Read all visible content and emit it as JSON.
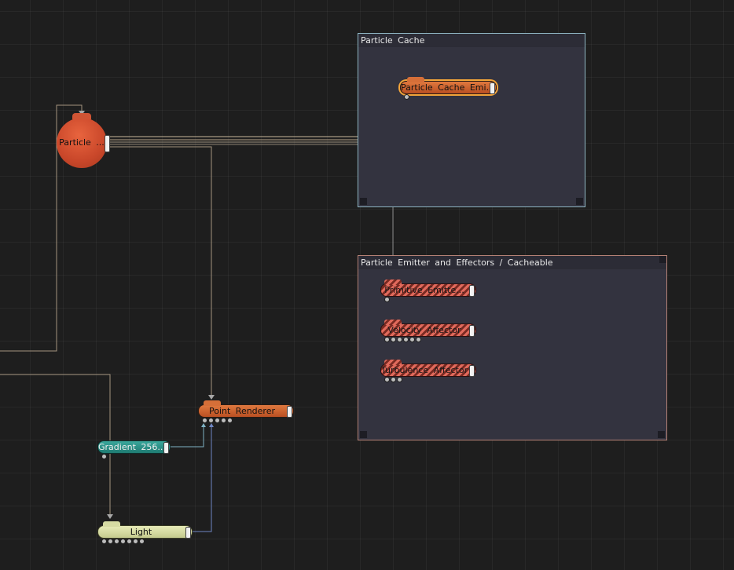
{
  "groups": {
    "cache": {
      "title": "Particle Cache"
    },
    "emitters": {
      "title": "Particle Emitter and Effectors / Cacheable"
    }
  },
  "nodes": {
    "particle_system": {
      "label": "Particle ..."
    },
    "cache_emitter": {
      "label": "Particle Cache Emi..."
    },
    "primitive_emitter": {
      "label": "Primitive Emitte..."
    },
    "velocity_affector": {
      "label": "Velocity Affector"
    },
    "turbulence_affector": {
      "label": "Turbulence Affector"
    },
    "point_renderer": {
      "label": "Point Renderer"
    },
    "gradient": {
      "label": "Gradient 256..."
    },
    "light": {
      "label": "Light"
    }
  },
  "colors": {
    "node_orange": "#d2622f",
    "node_teal": "#2c9488",
    "node_light": "#d6dba3",
    "node_hatched": "#e06a5c",
    "group_cache_border": "#8fb6c4",
    "group_emitter_border": "#b58276",
    "wire_tan": "#b5a48a",
    "wire_blue": "#6f86c4",
    "wire_teal": "#7fb2c4"
  }
}
